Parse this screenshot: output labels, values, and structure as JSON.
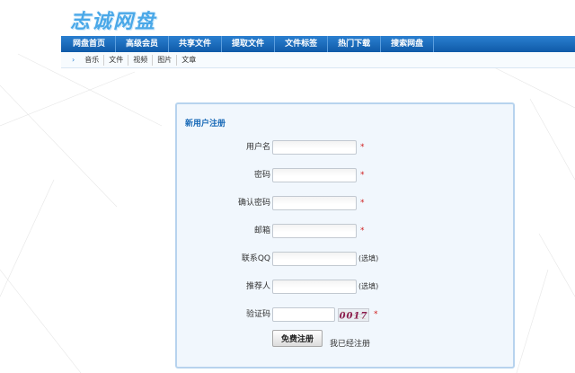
{
  "site": {
    "logo_text": "志诚网盘"
  },
  "nav": {
    "items": [
      {
        "label": "网盘首页"
      },
      {
        "label": "高级会员"
      },
      {
        "label": "共享文件"
      },
      {
        "label": "提取文件"
      },
      {
        "label": "文件标签"
      },
      {
        "label": "热门下载"
      },
      {
        "label": "搜索网盘"
      }
    ],
    "accent_color": "#1a6cbf"
  },
  "subnav": {
    "arrow_icon": "chevron-right-icon",
    "items": [
      {
        "label": "音乐"
      },
      {
        "label": "文件"
      },
      {
        "label": "视频"
      },
      {
        "label": "图片"
      },
      {
        "label": "文章"
      }
    ]
  },
  "form": {
    "title": "新用户注册",
    "fields": {
      "username": {
        "label": "用户名",
        "value": "",
        "required_mark": "*"
      },
      "password": {
        "label": "密码",
        "value": "",
        "required_mark": "*"
      },
      "confirm_password": {
        "label": "确认密码",
        "value": "",
        "required_mark": "*"
      },
      "email": {
        "label": "邮箱",
        "value": "",
        "required_mark": "*"
      },
      "qq": {
        "label": "联系QQ",
        "value": "",
        "optional_note": "(选填)"
      },
      "referrer": {
        "label": "推荐人",
        "value": "",
        "optional_note": "(选填)"
      },
      "captcha": {
        "label": "验证码",
        "value": "",
        "image_text": "0017",
        "required_mark": "*"
      }
    },
    "submit_label": "免费注册",
    "login_link": "我已经注册"
  }
}
